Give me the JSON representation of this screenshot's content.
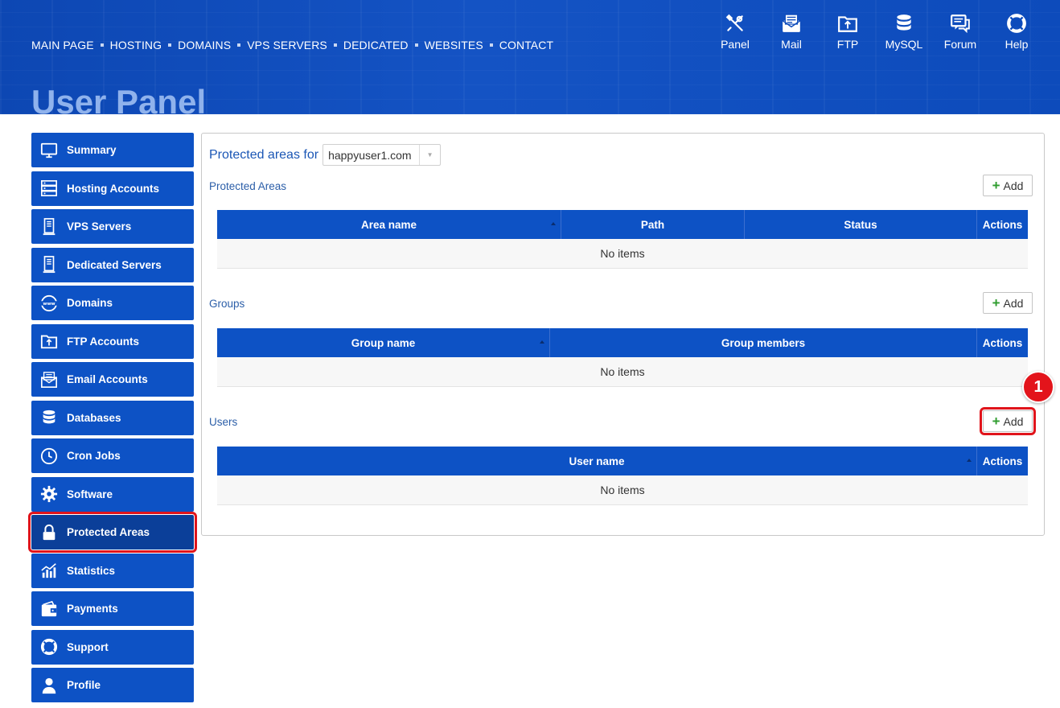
{
  "header": {
    "nav": [
      "MAIN PAGE",
      "HOSTING",
      "DOMAINS",
      "VPS SERVERS",
      "DEDICATED",
      "WEBSITES",
      "CONTACT"
    ],
    "quick_links": [
      {
        "label": "Panel",
        "icon": "tools-icon"
      },
      {
        "label": "Mail",
        "icon": "mail-icon"
      },
      {
        "label": "FTP",
        "icon": "ftp-folder-icon"
      },
      {
        "label": "MySQL",
        "icon": "database-icon"
      },
      {
        "label": "Forum",
        "icon": "forum-icon"
      },
      {
        "label": "Help",
        "icon": "lifebuoy-icon"
      }
    ],
    "title": "User Panel"
  },
  "sidebar": {
    "items": [
      {
        "label": "Summary",
        "icon": "monitor-icon"
      },
      {
        "label": "Hosting Accounts",
        "icon": "server-rack-icon"
      },
      {
        "label": "VPS Servers",
        "icon": "server-tower-icon"
      },
      {
        "label": "Dedicated Servers",
        "icon": "server-tower-icon"
      },
      {
        "label": "Domains",
        "icon": "www-globe-icon"
      },
      {
        "label": "FTP Accounts",
        "icon": "ftp-folder-icon"
      },
      {
        "label": "Email Accounts",
        "icon": "mail-icon"
      },
      {
        "label": "Databases",
        "icon": "database-icon"
      },
      {
        "label": "Cron Jobs",
        "icon": "clock-icon"
      },
      {
        "label": "Software",
        "icon": "gear-icon"
      },
      {
        "label": "Protected Areas",
        "icon": "lock-icon"
      },
      {
        "label": "Statistics",
        "icon": "chart-icon"
      },
      {
        "label": "Payments",
        "icon": "wallet-icon"
      },
      {
        "label": "Support",
        "icon": "lifebuoy-icon"
      },
      {
        "label": "Profile",
        "icon": "user-icon"
      }
    ],
    "active": "Protected Areas"
  },
  "main": {
    "for_label": "Protected areas for",
    "domain_value": "happyuser1.com",
    "add_label": "Add",
    "empty_text": "No items",
    "sections": {
      "areas": {
        "title": "Protected Areas",
        "columns": [
          "Area name",
          "Path",
          "Status",
          "Actions"
        ]
      },
      "groups": {
        "title": "Groups",
        "columns": [
          "Group name",
          "Group members",
          "Actions"
        ]
      },
      "users": {
        "title": "Users",
        "columns": [
          "User name",
          "Actions"
        ]
      }
    }
  },
  "annotation": {
    "step": "1"
  },
  "colors": {
    "primary": "#0d52c5",
    "highlight": "#e0141b",
    "title": "#8fb2ec"
  }
}
